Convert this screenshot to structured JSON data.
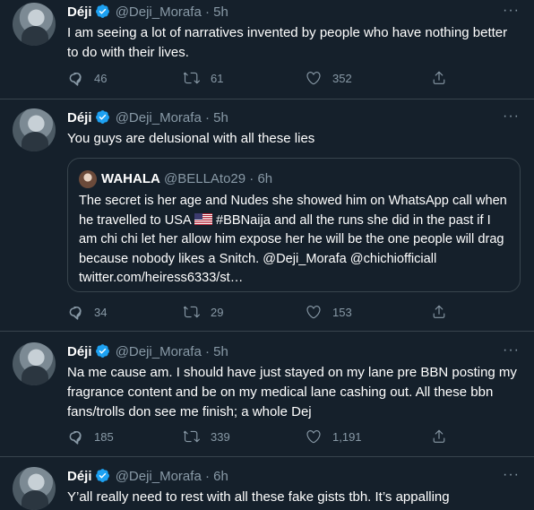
{
  "colors": {
    "background": "#15202b",
    "border": "#38444d",
    "muted": "#8899a6",
    "verified": "#1da1f2"
  },
  "icons": {
    "reply": "reply-icon",
    "retweet": "retweet-icon",
    "like": "heart-icon",
    "share": "share-icon",
    "more": "more-icon",
    "verified": "verified-badge-icon"
  },
  "tweets": [
    {
      "name": "Déji",
      "handle": "@Deji_Morafa",
      "dot": "·",
      "time": "5h",
      "more": "···",
      "text": "I am seeing a lot of narratives invented by people who have nothing better to do with their lives.",
      "replies": "46",
      "retweets": "61",
      "likes": "352"
    },
    {
      "name": "Déji",
      "handle": "@Deji_Morafa",
      "dot": "·",
      "time": "5h",
      "more": "···",
      "text": "You guys are delusional with all these lies",
      "quote": {
        "name": "WAHALA",
        "handle": "@BELLAto29",
        "dot": "·",
        "time": "6h",
        "text_before_flag": "The secret is her age and Nudes she showed him on WhatsApp call when he travelled to USA ",
        "text_after_flag": " #BBNaija and all the runs she did in the past if I am chi chi let her allow him expose her he will be the one people will drag because nobody likes a Snitch. @Deji_Morafa @chichiofficiall twitter.com/heiress6333/st…"
      },
      "replies": "34",
      "retweets": "29",
      "likes": "153"
    },
    {
      "name": "Déji",
      "handle": "@Deji_Morafa",
      "dot": "·",
      "time": "5h",
      "more": "···",
      "text": "Na me cause am. I should have just stayed on my lane pre BBN posting my fragrance content and be on my medical lane cashing out. All these bbn fans/trolls don see me finish; a whole Dej",
      "replies": "185",
      "retweets": "339",
      "likes": "1,191"
    },
    {
      "name": "Déji",
      "handle": "@Deji_Morafa",
      "dot": "·",
      "time": "6h",
      "more": "···",
      "text": "Y’all really need to rest with all these fake gists tbh. It’s appalling"
    }
  ]
}
